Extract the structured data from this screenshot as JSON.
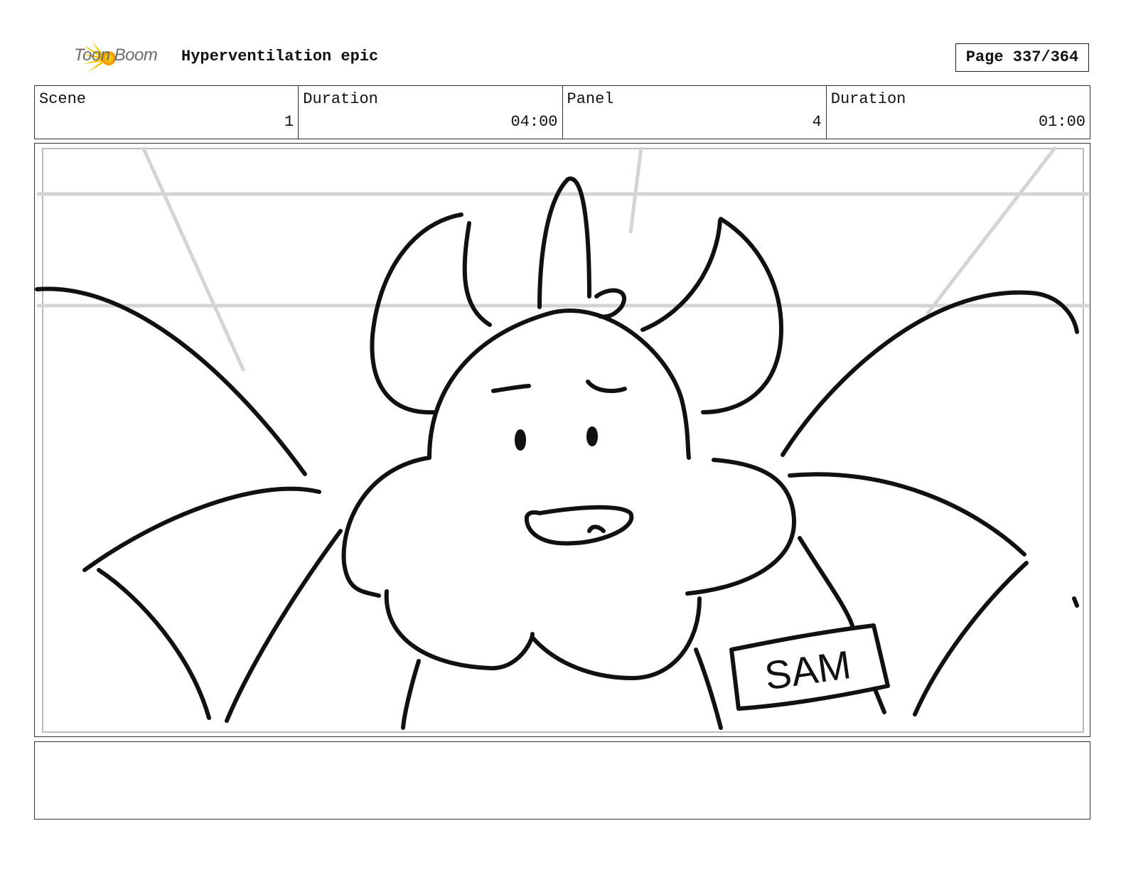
{
  "header": {
    "logo_text": "Toon Boom",
    "project_title": "Hyperventilation epic",
    "page_label": "Page 337/364"
  },
  "info": {
    "scene_label": "Scene",
    "scene_value": "1",
    "scene_duration_label": "Duration",
    "scene_duration_value": "04:00",
    "panel_label": "Panel",
    "panel_value": "4",
    "panel_duration_label": "Duration",
    "panel_duration_value": "01:00"
  },
  "panel": {
    "name_tag_text": "SAM"
  },
  "notes": {
    "text": ""
  },
  "colors": {
    "logo_yellow": "#f5c400",
    "logo_orange": "#f29c00",
    "sketch_line": "#111111",
    "guide_line": "#d4d4d4"
  }
}
